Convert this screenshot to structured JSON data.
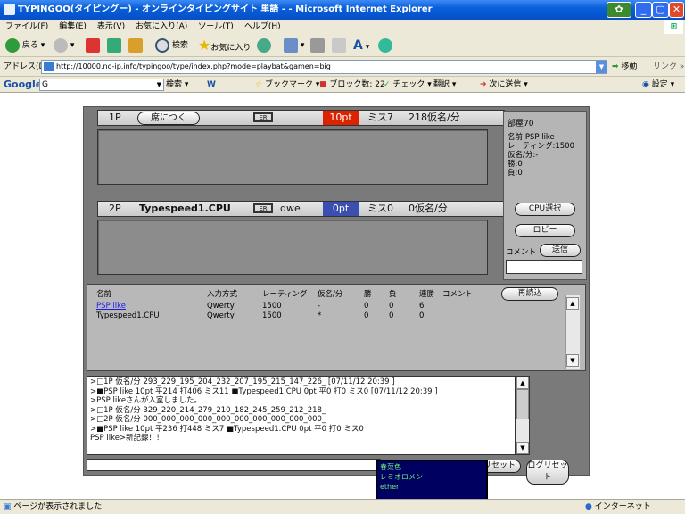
{
  "window": {
    "title": "TYPINGOO(タイピングー) - オンラインタイピングサイト 単語 - - Microsoft Internet Explorer"
  },
  "menu": [
    "ファイル(F)",
    "編集(E)",
    "表示(V)",
    "お気に入り(A)",
    "ツール(T)",
    "ヘルプ(H)"
  ],
  "toolbar": {
    "back": "戻る",
    "search": "検索",
    "favorites": "お気に入り"
  },
  "address": {
    "label": "アドレス(D)",
    "url": "http://10000.no-ip.info/typingoo/type/index.php?mode=playbat&gamen=big",
    "go": "移動",
    "links": "リンク"
  },
  "google": {
    "logo": "Google",
    "input": "G",
    "search": "検索",
    "bookmarks": "ブックマーク",
    "blocked": "ブロック数: 22",
    "check": "チェック",
    "translate": "翻訳",
    "send": "次に送信",
    "settings": "設定"
  },
  "p1": {
    "slot": "1P",
    "seat_button": "席につく",
    "mode_badge": "ER",
    "points": "10pt",
    "miss": "ミス7",
    "speed": "218仮名/分"
  },
  "p2": {
    "slot": "2P",
    "name": "Typespeed1.CPU",
    "mode_badge": "ER",
    "input": "qwe",
    "points": "0pt",
    "miss": "ミス0",
    "speed": "0仮名/分"
  },
  "room": {
    "title": "部屋70",
    "lines": [
      "名前:PSP like",
      "レーティング:1500",
      "仮名/分:-",
      "勝:0",
      "負:0"
    ],
    "cpu_button": "CPU選択",
    "lobby_button": "ロビー",
    "comment_label": "コメント",
    "send_button": "送信",
    "comment_value": ""
  },
  "table": {
    "headers": [
      "名前",
      "入力方式",
      "レーティング",
      "仮名/分",
      "勝",
      "負",
      "連勝",
      "コメント"
    ],
    "reload": "再読込",
    "rows": [
      [
        "PSP like",
        "Qwerty",
        "1500",
        "-",
        "0",
        "0",
        "6",
        ""
      ],
      [
        "Typespeed1.CPU",
        "Qwerty",
        "1500",
        "*",
        "0",
        "0",
        "0",
        ""
      ]
    ]
  },
  "log": [
    ">□1P 仮名/分  293_229_195_204_232_207_195_215_147_226_ [07/11/12 20:39 ]",
    ">■PSP like 10pt 平214 打406 ミス11 ■Typespeed1.CPU 0pt 平0 打0 ミス0 [07/11/12 20:39 ]",
    ">PSP likeさんが入室しました。",
    ">□1P 仮名/分  329_220_214_279_210_182_245_259_212_218_",
    ">□2P 仮名/分  000_000_000_000_000_000_000_000_000_000_",
    ">■PSP like 10pt 平236 打448 ミス7 ■Typespeed1.CPU 0pt 平0 打0 ミス0",
    "PSP like>新記録！！"
  ],
  "bottom": {
    "chat_value": "",
    "reset": "リセット",
    "log_reset": "ログリセット"
  },
  "popup": {
    "lines": [
      "春菜色",
      "レミオロメン",
      "ether"
    ],
    "slider_value": 0.55
  },
  "status": {
    "left": "ページが表示されました",
    "right": "インターネット"
  },
  "colors": {
    "points_active": "#dd2200",
    "points_p2": "#3a4fb0",
    "popup_bg": "#000060"
  }
}
